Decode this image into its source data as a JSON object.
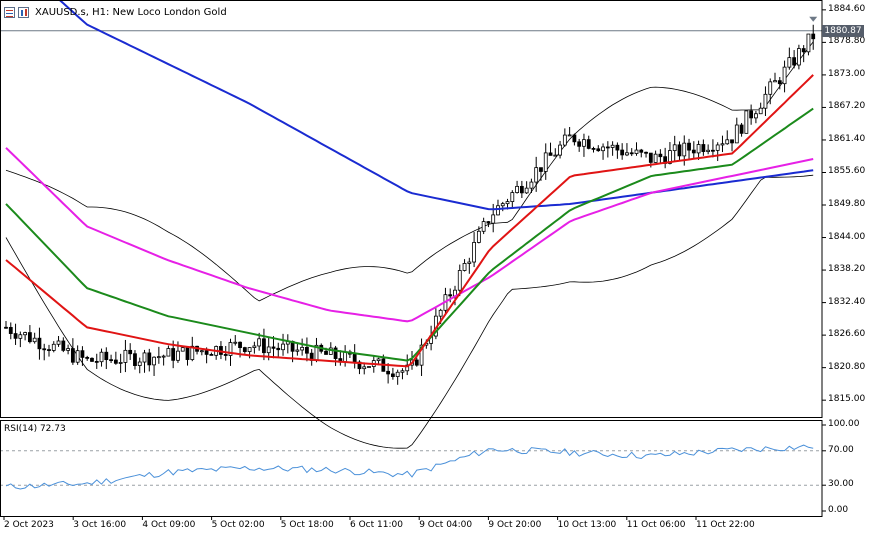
{
  "header": {
    "symbol_title": "XAUUSD.s, H1:  New Loco London Gold"
  },
  "price_axis": {
    "labels": [
      "1884.60",
      "1878.80",
      "1873.00",
      "1867.20",
      "1861.40",
      "1855.60",
      "1849.80",
      "1844.00",
      "1838.20",
      "1832.40",
      "1826.60",
      "1820.80",
      "1815.00"
    ],
    "current_price": "1880.87"
  },
  "rsi": {
    "label": "RSI(14) 72.73",
    "axis_labels": [
      "100.00",
      "70.00",
      "30.00",
      "0.00"
    ]
  },
  "time_axis": {
    "labels": [
      "2 Oct 2023",
      "3 Oct 16:00",
      "4 Oct 09:00",
      "5 Oct 02:00",
      "5 Oct 18:00",
      "6 Oct 11:00",
      "9 Oct 04:00",
      "9 Oct 20:00",
      "10 Oct 13:00",
      "11 Oct 06:00",
      "11 Oct 22:00"
    ]
  },
  "colors": {
    "background": "#ffffff",
    "grid_line": "#c8c8c8",
    "candle": "#000000",
    "ma_blue": "#1a2bd1",
    "ma_magenta": "#e620e6",
    "ma_green": "#1b8a1b",
    "ma_red": "#e01414",
    "bollinger": "#000000",
    "rsi_line": "#4a90d9",
    "rsi_level": "#9aa0a6",
    "price_tag_bg": "#555d6a"
  },
  "chart_data": {
    "type": "line",
    "title": "XAUUSD.s, H1:  New Loco London Gold",
    "ylim": [
      1812,
      1886
    ],
    "x": [
      "2 Oct 2023",
      "3 Oct 16:00",
      "4 Oct 09:00",
      "5 Oct 02:00",
      "5 Oct 18:00",
      "6 Oct 11:00",
      "9 Oct 04:00",
      "9 Oct 20:00",
      "10 Oct 13:00",
      "11 Oct 06:00",
      "11 Oct 22:00"
    ],
    "series": [
      {
        "values": [
          1828,
          1822,
          1823,
          1825,
          1823,
          1820,
          1848,
          1862,
          1858,
          1862,
          1880
        ]
      },
      {
        "values": [
          1895,
          1882,
          1875,
          1868,
          1860,
          1852,
          1849,
          1850,
          1852,
          1854,
          1856
        ]
      },
      {
        "values": [
          1860,
          1846,
          1840,
          1835,
          1831,
          1829,
          1837,
          1847,
          1852,
          1855,
          1858
        ]
      },
      {
        "values": [
          1850,
          1835,
          1830,
          1827,
          1824,
          1822,
          1838,
          1849,
          1855,
          1857,
          1867
        ]
      },
      {
        "values": [
          1840,
          1828,
          1825,
          1823,
          1822,
          1821,
          1842,
          1855,
          1857,
          1859,
          1873
        ]
      }
    ],
    "rsi_values": [
      28,
      32,
      45,
      50,
      48,
      42,
      72,
      68,
      64,
      71,
      75
    ],
    "rsi_levels": [
      70,
      30
    ]
  }
}
